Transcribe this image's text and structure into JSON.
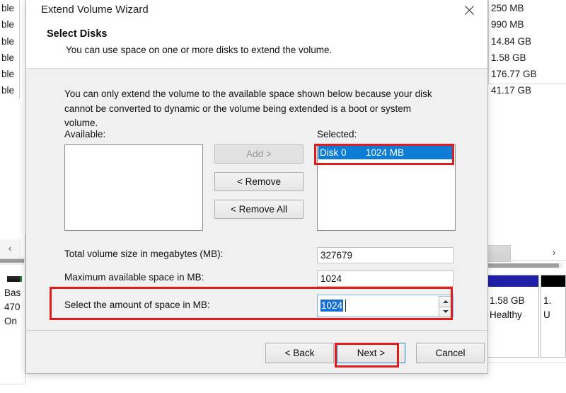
{
  "background": {
    "volume_list_rows": [
      "ble",
      "ble",
      "ble",
      "ble",
      "ble",
      "ble"
    ],
    "size_rows": [
      "250 MB",
      "990 MB",
      "14.84 GB",
      "1.58 GB",
      "176.77 GB",
      "41.17 GB"
    ],
    "left_scroll_arrow": "‹",
    "right_scroll_arrow": "›",
    "disk_info_lines": [
      "Bas",
      "470",
      "On"
    ],
    "partitions": [
      {
        "cap_color": "#1f1fa8",
        "line1": "1.58 GB",
        "line2": "Healthy"
      },
      {
        "cap_color": "#000000",
        "line1": "1.",
        "line2": "U"
      }
    ]
  },
  "dialog": {
    "title": "Extend Volume Wizard",
    "close_icon": "close-icon",
    "heading": "Select Disks",
    "subheading": "You can use space on one or more disks to extend the volume.",
    "intro": "You can only extend the volume to the available space shown below because your disk cannot be converted to dynamic or the volume being extended is a boot or system volume.",
    "available_label": "Available:",
    "selected_label": "Selected:",
    "available_items": [],
    "selected_items": [
      {
        "disk": "Disk 0",
        "size": "1024 MB",
        "highlighted": true
      }
    ],
    "mid_buttons": [
      {
        "label": "Add >",
        "disabled": true
      },
      {
        "label": "< Remove",
        "disabled": false
      },
      {
        "label": "< Remove All",
        "disabled": false
      }
    ],
    "fields": {
      "total_label": "Total volume size in megabytes (MB):",
      "total_value": "327679",
      "max_label": "Maximum available space in MB:",
      "max_value": "1024",
      "amount_label": "Select the amount of space in MB:",
      "amount_value": "1024"
    },
    "footer": {
      "back_label": "< Back",
      "next_label": "Next >",
      "cancel_label": "Cancel"
    }
  },
  "annotations": {
    "accent_color": "#e01b1b",
    "selection_color": "#0c7cd5",
    "focus_color": "#2a7fd4"
  }
}
